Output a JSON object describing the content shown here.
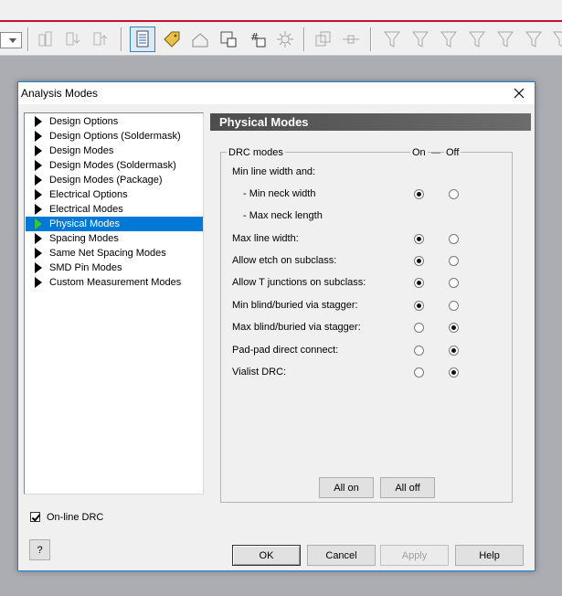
{
  "dialog": {
    "title": "Analysis Modes",
    "close_glyph": "✕"
  },
  "tree": {
    "items": [
      {
        "label": "Design Options",
        "selected": false
      },
      {
        "label": "Design Options (Soldermask)",
        "selected": false
      },
      {
        "label": "Design Modes",
        "selected": false
      },
      {
        "label": "Design Modes (Soldermask)",
        "selected": false
      },
      {
        "label": "Design Modes (Package)",
        "selected": false
      },
      {
        "label": "Electrical Options",
        "selected": false
      },
      {
        "label": "Electrical Modes",
        "selected": false
      },
      {
        "label": "Physical Modes",
        "selected": true
      },
      {
        "label": "Spacing Modes",
        "selected": false
      },
      {
        "label": "Same Net Spacing Modes",
        "selected": false
      },
      {
        "label": "SMD Pin Modes",
        "selected": false
      },
      {
        "label": "Custom Measurement Modes",
        "selected": false
      }
    ]
  },
  "panel": {
    "header": "Physical Modes",
    "group_title": "DRC modes",
    "col_on": "On",
    "col_off": "Off",
    "section_heading": "Min line width and:",
    "rows": [
      {
        "label": "- Min neck width",
        "value": "on"
      },
      {
        "label": "- Max neck length",
        "value": null
      },
      {
        "label": "Max line width:",
        "value": "on"
      },
      {
        "label": "Allow etch on subclass:",
        "value": "on"
      },
      {
        "label": "Allow T junctions on subclass:",
        "value": "on"
      },
      {
        "label": "Min blind/buried via stagger:",
        "value": "on"
      },
      {
        "label": "Max blind/buried via stagger:",
        "value": "off"
      },
      {
        "label": "Pad-pad direct connect:",
        "value": "off"
      },
      {
        "label": "Vialist DRC:",
        "value": "off"
      }
    ],
    "all_on_label": "All on",
    "all_off_label": "All off"
  },
  "footer": {
    "online_drc_label": "On-line DRC",
    "online_drc_checked": true,
    "help_q_label": "?",
    "ok_label": "OK",
    "cancel_label": "Cancel",
    "apply_label": "Apply",
    "help_label": "Help"
  },
  "colors": {
    "selection": "#0078d7",
    "dialog_border": "#1883d7",
    "header_bg": "#5a5a5a",
    "app_redline": "#c8102e"
  }
}
